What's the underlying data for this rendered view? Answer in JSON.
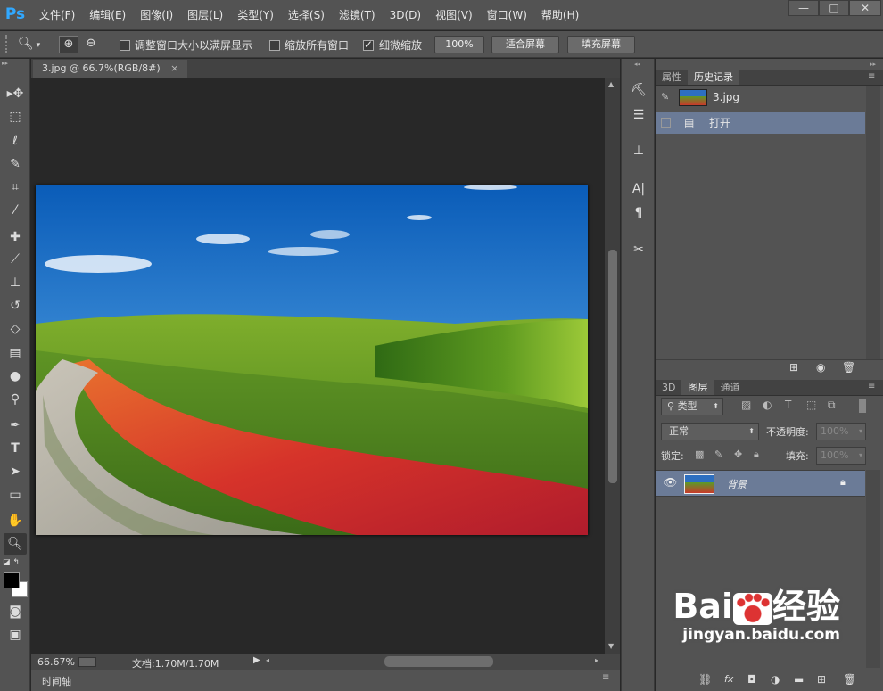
{
  "app": {
    "logo": "Ps"
  },
  "menus": [
    "文件(F)",
    "编辑(E)",
    "图像(I)",
    "图层(L)",
    "类型(Y)",
    "选择(S)",
    "滤镜(T)",
    "3D(D)",
    "视图(V)",
    "窗口(W)",
    "帮助(H)"
  ],
  "window_controls": {
    "minimize": "—",
    "maximize": "□",
    "close": "✕"
  },
  "options": {
    "resize_windows_label": "调整窗口大小以满屏显示",
    "resize_windows_checked": false,
    "zoom_all_label": "缩放所有窗口",
    "zoom_all_checked": false,
    "scrubby_zoom_label": "细微缩放",
    "scrubby_zoom_checked": true,
    "actual_pixels_btn": "100%",
    "fit_screen_btn": "适合屏幕",
    "fill_screen_btn": "填充屏幕"
  },
  "document": {
    "tab_title": "3.jpg @ 66.7%(RGB/8#)",
    "close": "×"
  },
  "status": {
    "zoom": "66.67%",
    "doc_info": "文档:1.70M/1.70M"
  },
  "timeline": {
    "label": "时间轴"
  },
  "history_panel": {
    "tabs": [
      "属性",
      "历史记录"
    ],
    "active_tab": "历史记录",
    "snapshot": "3.jpg",
    "steps": [
      "打开"
    ]
  },
  "layers_panel": {
    "tabs": [
      "3D",
      "图层",
      "通道"
    ],
    "active_tab": "图层",
    "filter_kind": "类型",
    "blend_mode": "正常",
    "opacity_label": "不透明度:",
    "opacity_value": "100%",
    "lock_label": "锁定:",
    "fill_label": "填充:",
    "fill_value": "100%",
    "layers": [
      {
        "name": "背景",
        "visible": true,
        "locked": true
      }
    ]
  },
  "watermark": {
    "brand": "Bai",
    "brand2": "经验",
    "url": "jingyan.baidu.com"
  }
}
